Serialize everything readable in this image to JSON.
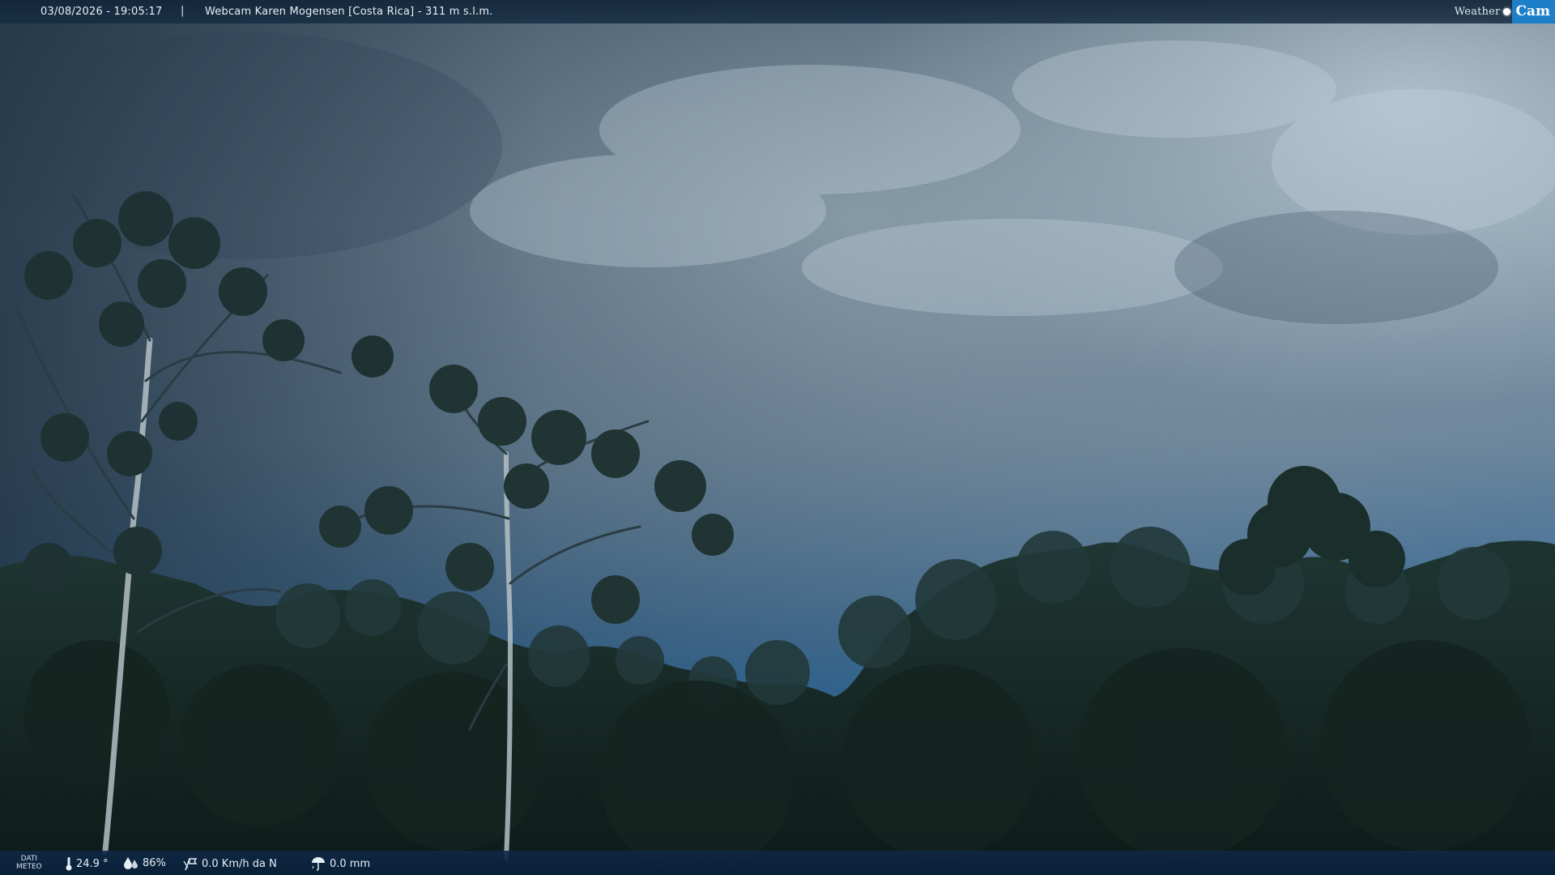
{
  "header": {
    "datetime": "03/08/2026 - 19:05:17",
    "separator": "|",
    "camera_title": "Webcam Karen Mogensen [Costa Rica]  - 311 m s.l.m."
  },
  "logo": {
    "word1": "Weather",
    "word2": "Cam",
    "accent_color": "#1e7fc9"
  },
  "weather_bar": {
    "label_line1": "DATI",
    "label_line2": "METEO",
    "temperature": "24.9 °",
    "humidity": "86%",
    "wind": "0.0 Km/h da N",
    "rain": "0.0 mm",
    "icons": [
      "thermometer-icon",
      "humidity-icon",
      "wind-icon",
      "rain-icon"
    ]
  },
  "scene": {
    "description_colors": {
      "sky_top": "#3e5363",
      "sky_mid": "#7e94a6",
      "sky_horizon": "#2f6c9e",
      "forest_dark": "#0f1d1b",
      "forest_mid": "#1e3430"
    }
  }
}
